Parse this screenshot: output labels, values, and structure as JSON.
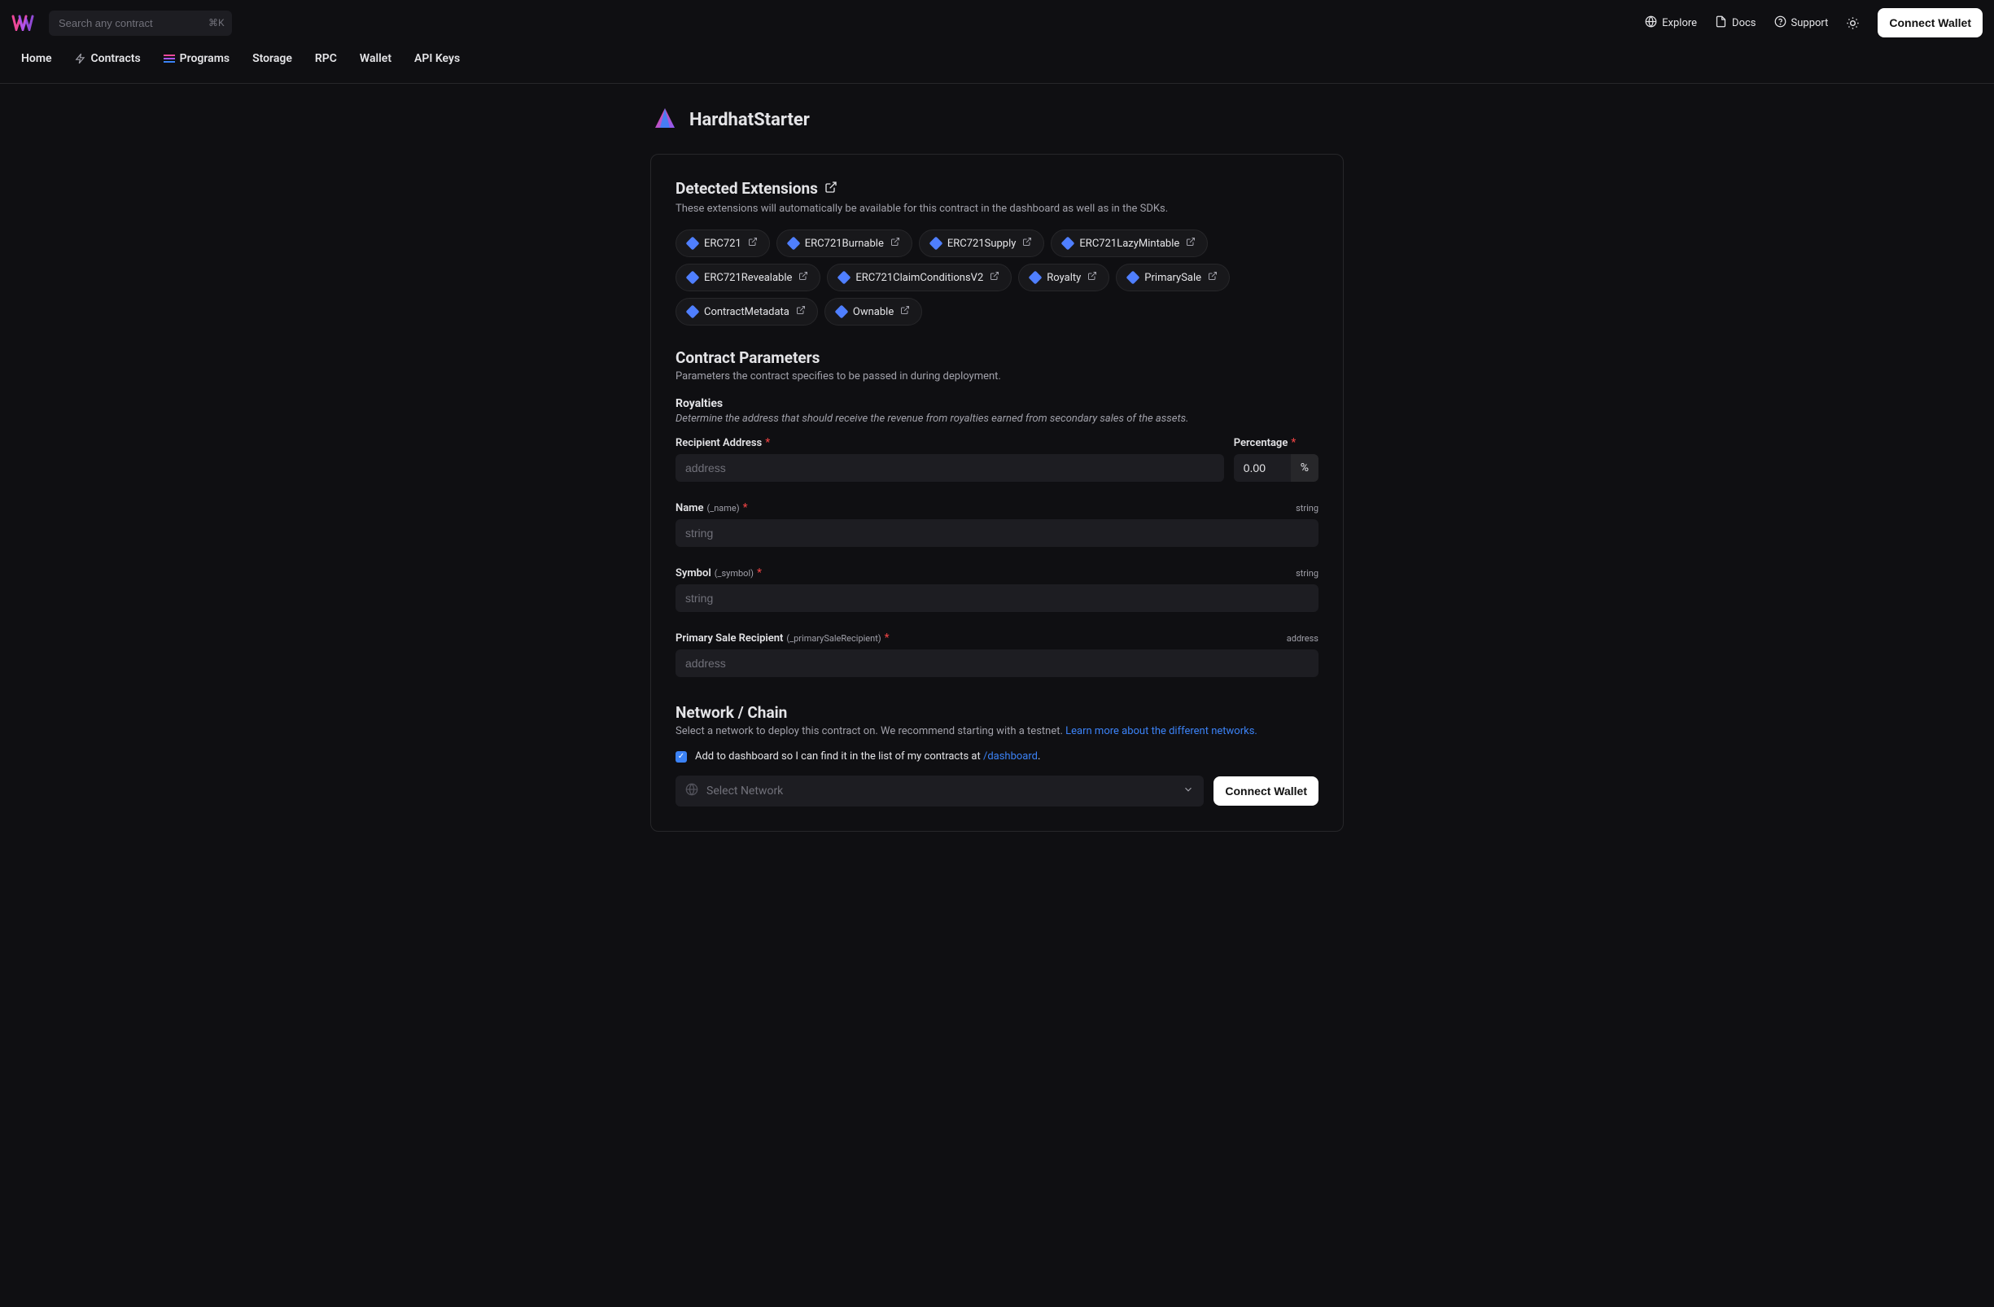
{
  "header": {
    "search_placeholder": "Search any contract",
    "search_kbd": "⌘K",
    "links": {
      "explore": "Explore",
      "docs": "Docs",
      "support": "Support"
    },
    "connect_wallet": "Connect Wallet"
  },
  "nav": {
    "home": "Home",
    "contracts": "Contracts",
    "programs": "Programs",
    "storage": "Storage",
    "rpc": "RPC",
    "wallet": "Wallet",
    "api_keys": "API Keys"
  },
  "page": {
    "title": "HardhatStarter"
  },
  "extensions": {
    "heading": "Detected Extensions",
    "sub": "These extensions will automatically be available for this contract in the dashboard as well as in the SDKs.",
    "items": [
      "ERC721",
      "ERC721Burnable",
      "ERC721Supply",
      "ERC721LazyMintable",
      "ERC721Revealable",
      "ERC721ClaimConditionsV2",
      "Royalty",
      "PrimarySale",
      "ContractMetadata",
      "Ownable"
    ]
  },
  "params": {
    "heading": "Contract Parameters",
    "sub": "Parameters the contract specifies to be passed in during deployment.",
    "royalties": {
      "heading": "Royalties",
      "sub": "Determine the address that should receive the revenue from royalties earned from secondary sales of the assets.",
      "recipient_label": "Recipient Address",
      "recipient_placeholder": "address",
      "percentage_label": "Percentage",
      "percentage_value": "0.00",
      "percentage_suffix": "%"
    },
    "name": {
      "label": "Name",
      "sub": "(_name)",
      "type": "string",
      "placeholder": "string"
    },
    "symbol": {
      "label": "Symbol",
      "sub": "(_symbol)",
      "type": "string",
      "placeholder": "string"
    },
    "primary": {
      "label": "Primary Sale Recipient",
      "sub": "(_primarySaleRecipient)",
      "type": "address",
      "placeholder": "address"
    }
  },
  "network": {
    "heading": "Network / Chain",
    "sub_pre": "Select a network to deploy this contract on. We recommend starting with a testnet. ",
    "sub_link": "Learn more about the different networks.",
    "checkbox_label_pre": "Add to dashboard so I can find it in the list of my contracts at ",
    "checkbox_link": "/dashboard",
    "checkbox_suffix": ".",
    "select_placeholder": "Select Network",
    "connect_wallet": "Connect Wallet"
  }
}
